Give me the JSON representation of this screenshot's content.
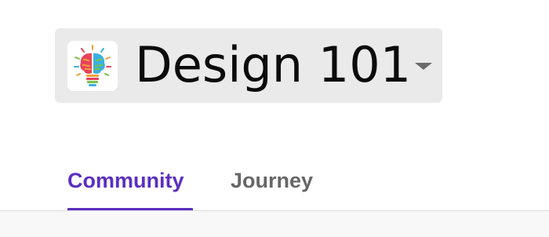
{
  "group": {
    "name": "Design 101",
    "logo_icon": "lightbulb-brain-logo",
    "caret_icon": "caret-down-icon"
  },
  "tabs": [
    {
      "label": "Community",
      "active": true
    },
    {
      "label": "Journey",
      "active": false
    }
  ],
  "colors": {
    "accent": "#5b2fbf",
    "switcher_bg": "#eaeaea",
    "inactive_tab": "#666666"
  }
}
